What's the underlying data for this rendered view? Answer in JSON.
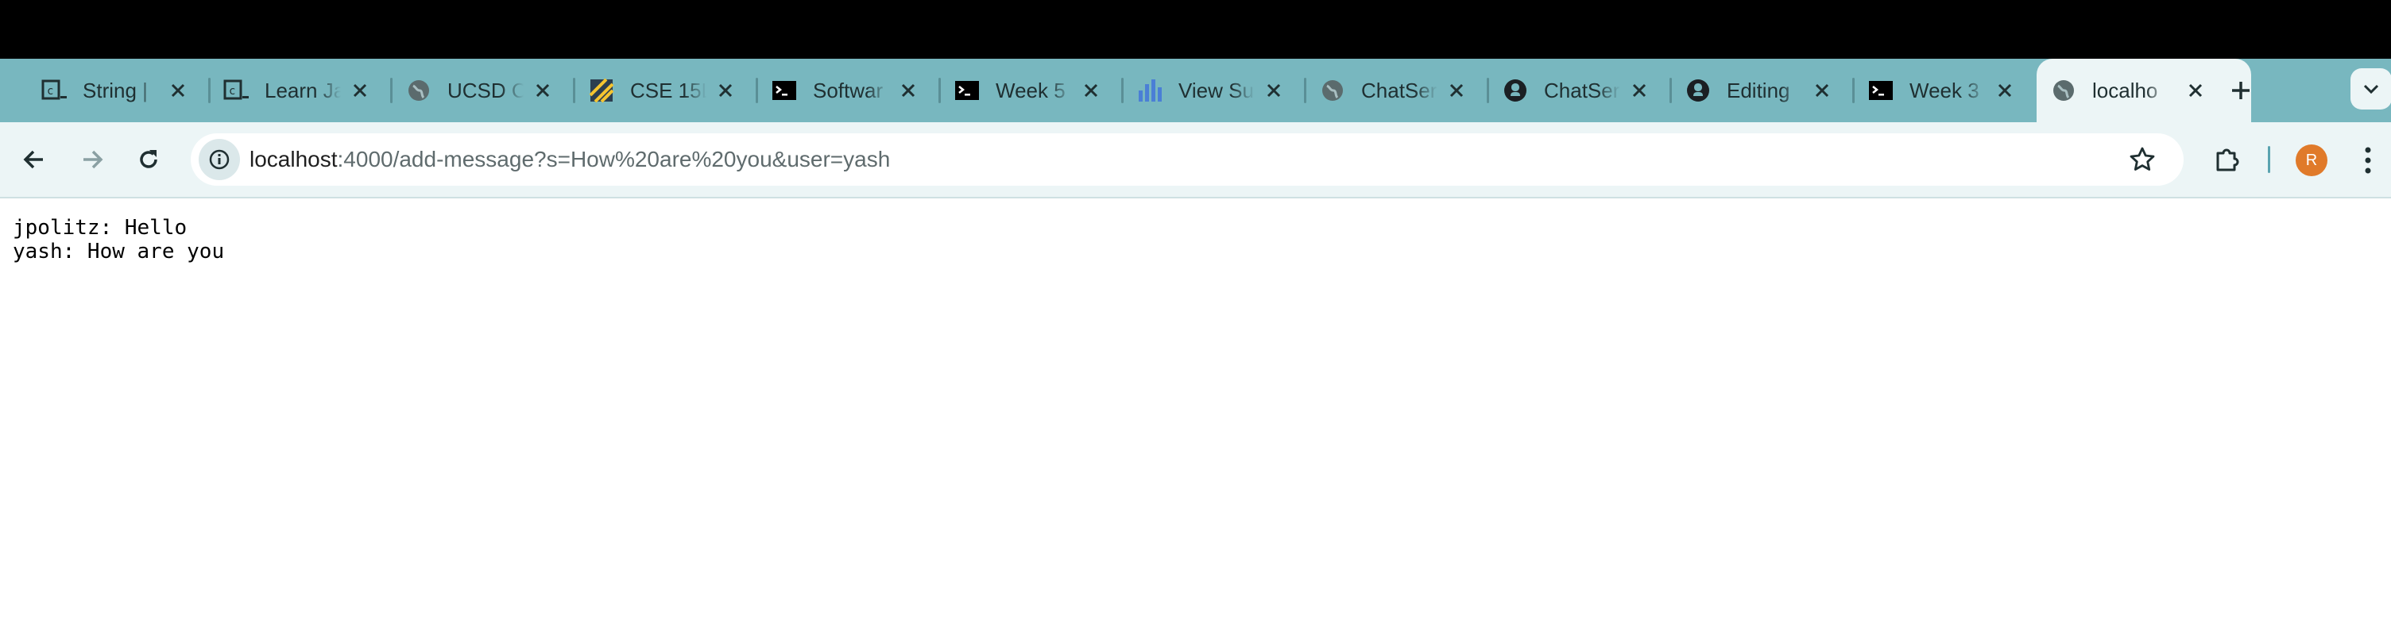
{
  "browser": {
    "tabs": [
      {
        "title": "String |",
        "icon": "terminal-c-icon"
      },
      {
        "title": "Learn Ja",
        "icon": "terminal-c-icon"
      },
      {
        "title": "UCSD C",
        "icon": "globe-icon"
      },
      {
        "title": "CSE 15L",
        "icon": "stripes-icon"
      },
      {
        "title": "Softwar",
        "icon": "terminal-icon"
      },
      {
        "title": "Week 5",
        "icon": "terminal-icon"
      },
      {
        "title": "View Su",
        "icon": "bar-chart-icon"
      },
      {
        "title": "ChatSer",
        "icon": "globe-icon"
      },
      {
        "title": "ChatSer",
        "icon": "github-icon"
      },
      {
        "title": "Editing",
        "icon": "github-icon"
      },
      {
        "title": "Week 3",
        "icon": "terminal-icon"
      },
      {
        "title": "localho",
        "icon": "globe-icon",
        "active": true
      }
    ],
    "address_bar": {
      "host": "localhost",
      "rest": ":4000/add-message?s=How%20are%20you&user=yash"
    },
    "profile_initial": "R"
  },
  "page": {
    "lines": [
      "jpolitz: Hello",
      "yash: How are you"
    ]
  },
  "colors": {
    "tab_strip": "#78b7bf",
    "toolbar": "#ecf5f6",
    "avatar": "#e07a2a"
  }
}
